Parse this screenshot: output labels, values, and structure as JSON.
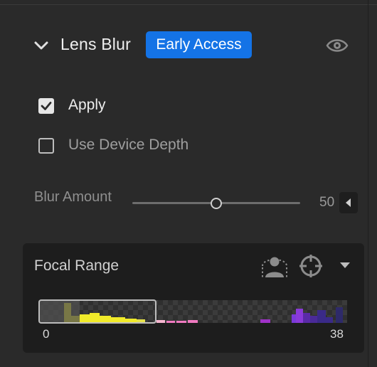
{
  "panel": {
    "title": "Lens Blur",
    "badge": "Early Access",
    "icons": {
      "collapse": "chevron-down-icon",
      "visibility": "eye-icon"
    }
  },
  "options": {
    "apply": {
      "label": "Apply",
      "checked": true
    },
    "use_device_depth": {
      "label": "Use Device Depth",
      "checked": false
    }
  },
  "blur_amount": {
    "label": "Blur Amount",
    "value": "50",
    "slider_fraction": 0.5
  },
  "focal_range": {
    "label": "Focal Range",
    "min": "0",
    "max": "38",
    "selection_fraction": [
      0.0,
      0.38
    ],
    "icons": {
      "subject": "person-select-icon",
      "point": "target-icon",
      "menu": "triangle-down-icon"
    }
  },
  "colors": {
    "accent": "#1473e6",
    "histogram_near": "#f0ea2a",
    "histogram_mid": "#f07ac0",
    "histogram_far": "#7a3ad8"
  }
}
